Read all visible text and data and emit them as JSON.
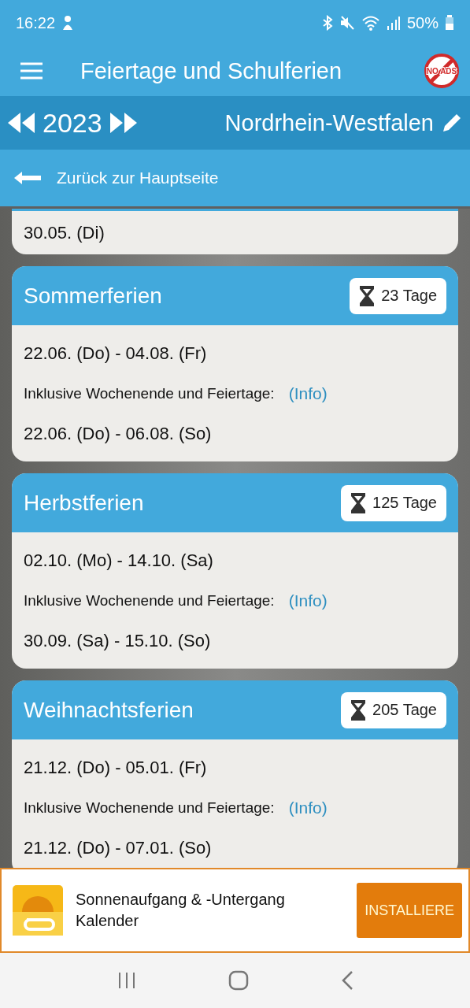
{
  "status_bar": {
    "time": "16:22",
    "battery": "50%"
  },
  "app_bar": {
    "title": "Feiertage und Schulferien",
    "no_ads_badge": "NO ADS"
  },
  "year_bar": {
    "year": "2023",
    "region": "Nordrhein-Westfalen"
  },
  "back_link": {
    "label": "Zurück zur Hauptseite"
  },
  "partial_card": {
    "date": "30.05. (Di)"
  },
  "holidays": [
    {
      "name": "Sommerferien",
      "countdown": "23 Tage",
      "range": "22.06. (Do) - 04.08. (Fr)",
      "note": "Inklusive Wochenende und Feiertage:",
      "info": "(Info)",
      "range_inclusive": "22.06. (Do) - 06.08. (So)"
    },
    {
      "name": "Herbstferien",
      "countdown": "125 Tage",
      "range": "02.10. (Mo) - 14.10. (Sa)",
      "note": "Inklusive Wochenende und Feiertage:",
      "info": "(Info)",
      "range_inclusive": "30.09. (Sa) - 15.10. (So)"
    },
    {
      "name": "Weihnachtsferien",
      "countdown": "205 Tage",
      "range": "21.12. (Do) - 05.01. (Fr)",
      "note": "Inklusive Wochenende und Feiertage:",
      "info": "(Info)",
      "range_inclusive": "21.12. (Do) - 07.01. (So)"
    }
  ],
  "ad": {
    "title": "Sonnenaufgang & -Untergang Kalender",
    "button": "INSTALLIERE"
  }
}
